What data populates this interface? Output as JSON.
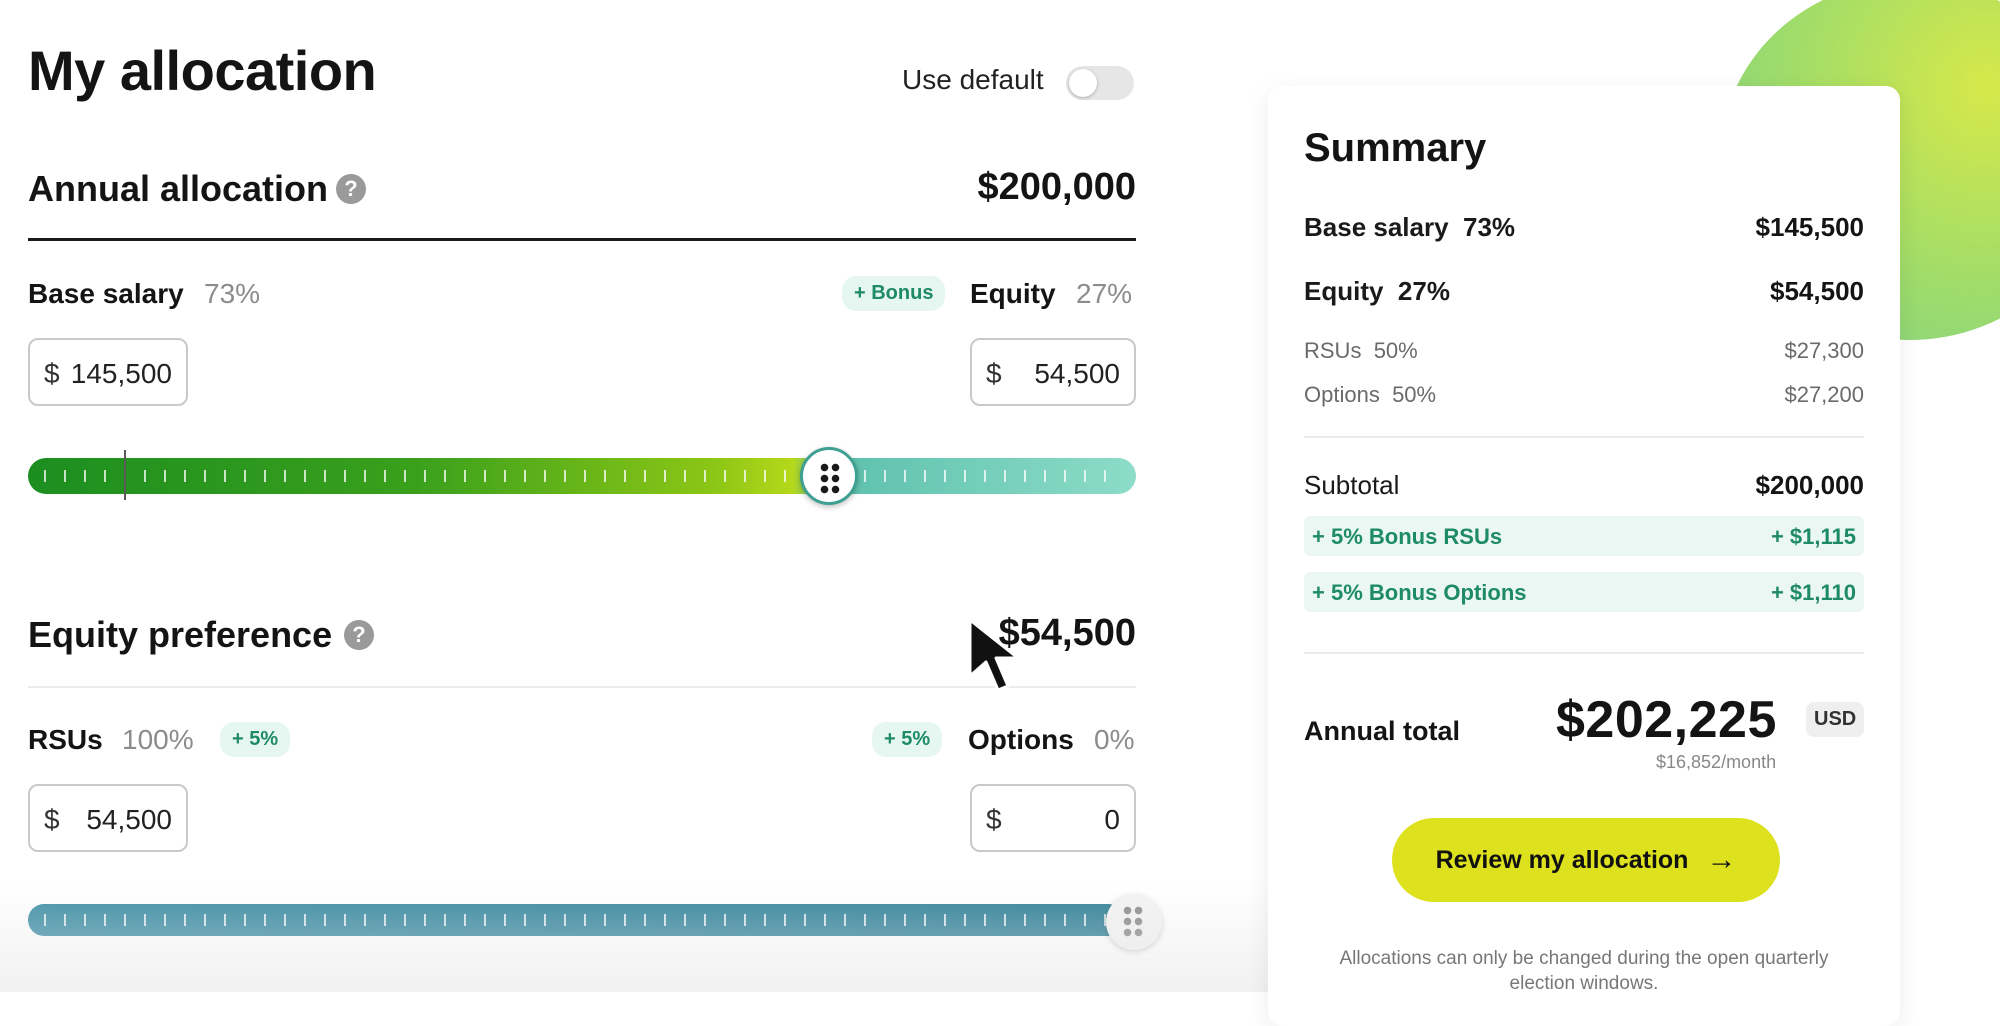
{
  "header": {
    "title": "My allocation",
    "use_default_label": "Use default",
    "use_default_on": false
  },
  "annual": {
    "title": "Annual allocation",
    "total": "$200,000",
    "base_label": "Base salary",
    "base_pct": "73%",
    "bonus_chip": "+ Bonus",
    "equity_label": "Equity",
    "equity_pct": "27%",
    "base_currency": "$",
    "base_value": "145,500",
    "equity_currency": "$",
    "equity_value": "54,500",
    "slider_fraction": 0.73
  },
  "equity_pref": {
    "title": "Equity preference",
    "total": "$54,500",
    "rsus_label": "RSUs",
    "rsus_pct": "100%",
    "rsus_chip": "+ 5%",
    "options_chip": "+ 5%",
    "options_label": "Options",
    "options_pct": "0%",
    "rsus_currency": "$",
    "rsus_value": "54,500",
    "options_currency": "$",
    "options_value": "0",
    "slider_fraction": 1.0
  },
  "summary": {
    "title": "Summary",
    "rows": [
      {
        "label": "Base salary",
        "pct": "73%",
        "value": "$145,500"
      },
      {
        "label": "Equity",
        "pct": "27%",
        "value": "$54,500"
      }
    ],
    "sub_rows": [
      {
        "label": "RSUs",
        "pct": "50%",
        "value": "$27,300"
      },
      {
        "label": "Options",
        "pct": "50%",
        "value": "$27,200"
      }
    ],
    "subtotal_label": "Subtotal",
    "subtotal_value": "$200,000",
    "bonus_rows": [
      {
        "label": "+ 5% Bonus RSUs",
        "value": "+ $1,115"
      },
      {
        "label": "+ 5% Bonus Options",
        "value": "+ $1,110"
      }
    ],
    "annual_total_label": "Annual total",
    "annual_total_value": "$202,225",
    "currency_badge": "USD",
    "per_month": "$16,852/month",
    "cta_label": "Review my allocation",
    "cta_arrow": "→",
    "note": "Allocations can only be changed during the open quarterly election windows."
  },
  "colors": {
    "accent_green": "#1e8a68",
    "cta_yellow": "#dde11e",
    "slider_start": "#1c8e20",
    "slider_end": "#8cdcc8",
    "equity_slider": "#3f8fa5"
  },
  "icons": [
    "help-icon",
    "drag-handle-icon",
    "arrow-right-icon",
    "cursor-pointer-icon"
  ]
}
